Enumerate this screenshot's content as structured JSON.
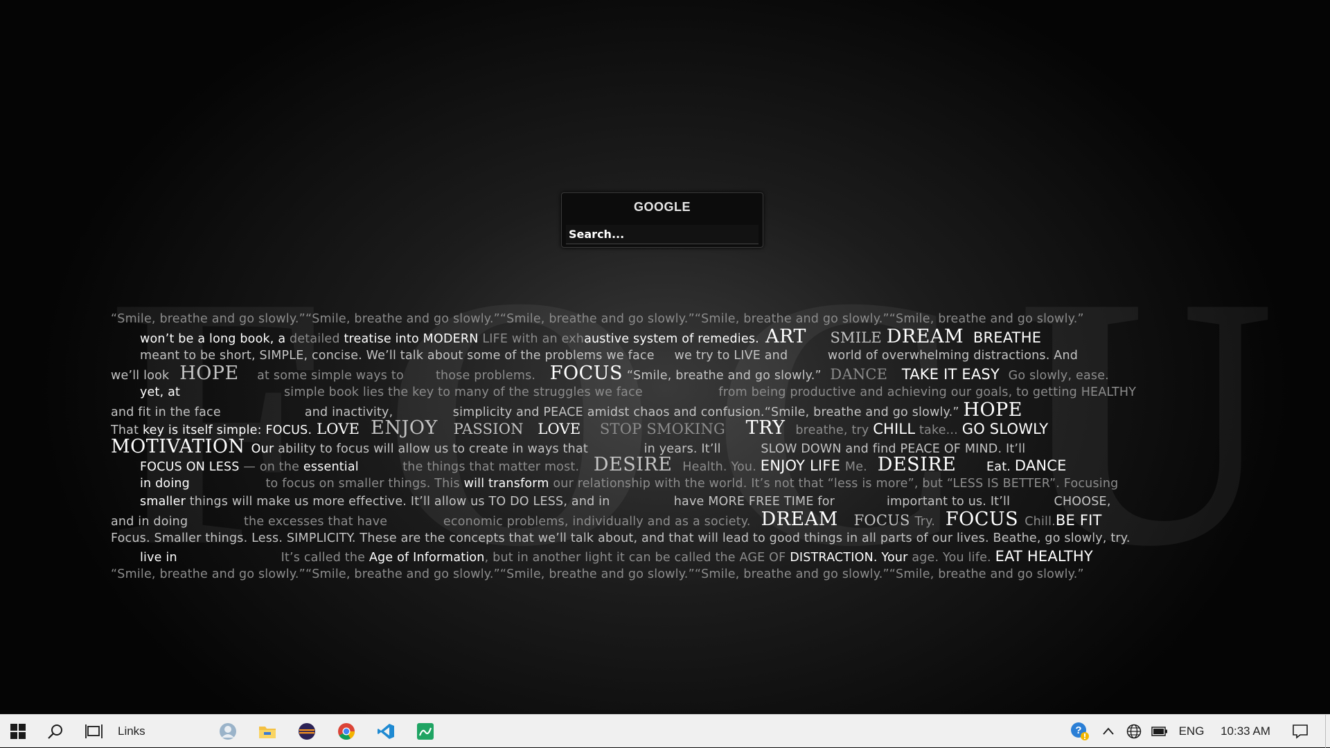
{
  "search_widget": {
    "title": "GOOGLE",
    "placeholder": "Search..."
  },
  "wallpaper": {
    "background_word": "FOCUS",
    "lines": [
      [
        [
          "d",
          "“Smile, breathe and go slowly.”“Smile, breathe and go slowly.”“Smile, breathe and go slowly.”“Smile, breathe and go slowly.”“Smile, breathe and go slowly.”"
        ]
      ],
      [
        [
          "b",
          "won’t be a long book, a "
        ],
        [
          "d",
          "detailed "
        ],
        [
          "b",
          "treatise into MODERN "
        ],
        [
          "d",
          "LIFE with an exh"
        ],
        [
          "b",
          "austive system of remedies."
        ],
        [
          "b big",
          " ART"
        ],
        [
          "d",
          "      "
        ],
        [
          "m ser",
          "SMILE "
        ],
        [
          "b big",
          "DREAM"
        ],
        [
          "b sans-b",
          "  BREATHE"
        ]
      ],
      [
        [
          "m",
          "meant to be short, SIMPLE, concise. We’ll talk about some of the problems we face     we try to LIVE and          world of overwhelming distractions. And"
        ]
      ],
      [
        [
          "m",
          "we’ll look "
        ],
        [
          "m big",
          " HOPE "
        ],
        [
          "d",
          "   at some simple ways to        those problems.  "
        ],
        [
          "b big",
          " FOCUS"
        ],
        [
          "m",
          " “Smile, breathe and go slowly.” "
        ],
        [
          "d ser",
          " DANCE "
        ],
        [
          "b sans-b",
          "  TAKE IT EASY "
        ],
        [
          "d",
          " Go slowly, ease."
        ]
      ],
      [
        [
          "b",
          "yet, at"
        ],
        [
          "d",
          "                          simple book lies the key to many of the struggles we face                   from being productive and achieving our goals, to getting HEALTHY"
        ]
      ],
      [
        [
          "m",
          "and fit in the face                     and inactivity,               simplicity and PEACE amidst chaos and confusion.“Smile, breathe and go slowly.” "
        ],
        [
          "b big",
          "HOPE"
        ]
      ],
      [
        [
          "m",
          "That "
        ],
        [
          "b",
          "key is itself simple: FOCUS."
        ],
        [
          "b ser",
          " LOVE "
        ],
        [
          "m big",
          " ENJOY "
        ],
        [
          "m ser",
          "  PASSION  "
        ],
        [
          "b ser",
          " LOVE  "
        ],
        [
          "d ser",
          "  STOP SMOKING   "
        ],
        [
          "b big",
          " TRY "
        ],
        [
          "d",
          " breathe, try "
        ],
        [
          "b sans-b",
          "CHILL"
        ],
        [
          "d",
          " take... "
        ],
        [
          "b sans-b",
          "GO SLOWLY"
        ]
      ],
      [
        [
          "b big",
          "MOTIVATION "
        ],
        [
          "b",
          "Our "
        ],
        [
          "m",
          "ability to focus will allow us to create in ways that              in years. It’ll          SLOW DOWN and find PEACE OF MIND. It’ll"
        ]
      ],
      [
        [
          "b",
          "FOCUS ON LESS "
        ],
        [
          "d",
          "— on the "
        ],
        [
          "b",
          "essential        "
        ],
        [
          "d",
          "   the things that matter most.  "
        ],
        [
          "m big",
          " DESIRE "
        ],
        [
          "d",
          " Health. You. "
        ],
        [
          "b sans-b",
          "ENJOY LIFE "
        ],
        [
          "d",
          "Me. "
        ],
        [
          "b big",
          " DESIRE "
        ],
        [
          "d",
          "      "
        ],
        [
          "b",
          "Eat. "
        ],
        [
          "b sans-b",
          "DANCE"
        ]
      ],
      [
        [
          "b",
          "in doing"
        ],
        [
          "d",
          "                   to focus on smaller things. This "
        ],
        [
          "b",
          "will transform "
        ],
        [
          "d",
          "our relationship with the world. It’s not that “less is more”, but “LESS IS BETTER”. Focusing"
        ]
      ],
      [
        [
          "b",
          "smaller "
        ],
        [
          "m",
          "things will make us more effective. It’ll allow us TO DO LESS, and in                have MORE FREE TIME for             important to us. It’ll           CHOOSE,"
        ]
      ],
      [
        [
          "m",
          "and in doing"
        ],
        [
          "d",
          "              the excesses that have              economic problems, individually and as a society. "
        ],
        [
          "b big",
          " DREAM "
        ],
        [
          "m ser",
          "  FOCUS "
        ],
        [
          "d",
          "Try. "
        ],
        [
          "b big",
          " FOCUS "
        ],
        [
          "d",
          "Chill."
        ],
        [
          "b sans-b",
          "BE FIT"
        ]
      ],
      [
        [
          "m",
          "Focus. Smaller things. Less. SIMPLICITY. These are the concepts that we’ll talk about, and that will lead to good things in all parts of our lives. Beathe, go slowly, try."
        ]
      ],
      [
        [
          "b",
          "live in"
        ],
        [
          "d",
          "                          It’s called the "
        ],
        [
          "b",
          "Age of Information"
        ],
        [
          "d",
          ", but in another light it can be called the AGE OF "
        ],
        [
          "b",
          "DISTRACTION. Your "
        ],
        [
          "d",
          "age. You life. "
        ],
        [
          "b sans-b",
          "EAT HEALTHY"
        ]
      ],
      [
        [
          "d",
          "“Smile, breathe and go slowly.”“Smile, breathe and go slowly.”“Smile, breathe and go slowly.”“Smile, breathe and go slowly.”“Smile, breathe and go slowly.”"
        ]
      ]
    ]
  },
  "taskbar": {
    "links_label": "Links",
    "apps": [
      "user-app-icon",
      "file-explorer-icon",
      "eclipse-icon",
      "chrome-icon",
      "vscode-icon",
      "whiteboard-icon"
    ],
    "tray": {
      "language": "ENG",
      "time": "10:33 AM"
    }
  },
  "colors": {
    "taskbar_bg": "#f0f0f0",
    "widget_bg": "#0c0c0c"
  }
}
